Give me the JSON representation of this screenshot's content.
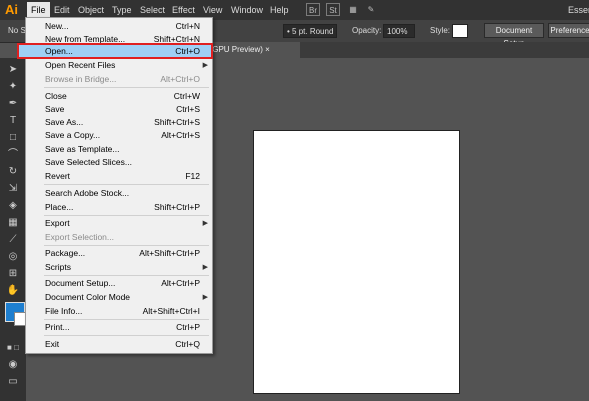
{
  "menubar": {
    "logo": "Ai",
    "items": [
      "File",
      "Edit",
      "Object",
      "Type",
      "Select",
      "Effect",
      "View",
      "Window",
      "Help"
    ],
    "right_label": "Essen",
    "app_buttons": [
      "Br",
      "St"
    ]
  },
  "ctrlbar": {
    "left_label": "No Se",
    "stroke_label": "5 pt. Round",
    "opacity_label": "Opacity:",
    "opacity_value": "100%",
    "style_label": "Style:",
    "doc_setup": "Document Setup",
    "preferences": "Preferences"
  },
  "doc_tab": "/GPU Preview)",
  "file_menu": [
    {
      "label": "New...",
      "shortcut": "Ctrl+N"
    },
    {
      "label": "New from Template...",
      "shortcut": "Shift+Ctrl+N"
    },
    {
      "label": "Open...",
      "shortcut": "Ctrl+O"
    },
    {
      "label": "Open Recent Files",
      "shortcut": ""
    },
    {
      "label": "Browse in Bridge...",
      "shortcut": "Alt+Ctrl+O"
    },
    {
      "label": "Close",
      "shortcut": "Ctrl+W"
    },
    {
      "label": "Save",
      "shortcut": "Ctrl+S"
    },
    {
      "label": "Save As...",
      "shortcut": "Shift+Ctrl+S"
    },
    {
      "label": "Save a Copy...",
      "shortcut": "Alt+Ctrl+S"
    },
    {
      "label": "Save as Template...",
      "shortcut": ""
    },
    {
      "label": "Save Selected Slices...",
      "shortcut": ""
    },
    {
      "label": "Revert",
      "shortcut": "F12"
    },
    {
      "label": "Search Adobe Stock...",
      "shortcut": ""
    },
    {
      "label": "Place...",
      "shortcut": "Shift+Ctrl+P"
    },
    {
      "label": "Export",
      "shortcut": ""
    },
    {
      "label": "Export Selection...",
      "shortcut": ""
    },
    {
      "label": "Package...",
      "shortcut": "Alt+Shift+Ctrl+P"
    },
    {
      "label": "Scripts",
      "shortcut": ""
    },
    {
      "label": "Document Setup...",
      "shortcut": "Alt+Ctrl+P"
    },
    {
      "label": "Document Color Mode",
      "shortcut": ""
    },
    {
      "label": "File Info...",
      "shortcut": "Alt+Shift+Ctrl+I"
    },
    {
      "label": "Print...",
      "shortcut": "Ctrl+P"
    },
    {
      "label": "Exit",
      "shortcut": "Ctrl+Q"
    }
  ],
  "colors": {
    "highlight": "#9fd0f5",
    "highlight_border": "#e02020",
    "fill_swatch": "#1e7fd0"
  }
}
